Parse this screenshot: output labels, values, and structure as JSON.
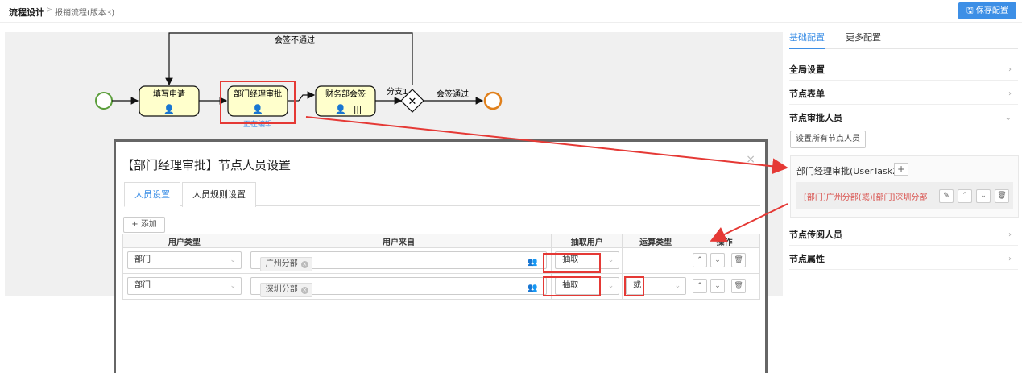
{
  "breadcrumb": {
    "root": "流程设计",
    "sep": ">",
    "current": "报销流程(版本3)"
  },
  "toolbar": {
    "save_label": "保存配置"
  },
  "diagram": {
    "loop_label": "会签不通过",
    "nodes": {
      "fill": "填写申请",
      "manager": "部门经理审批",
      "finance": "财务部会签"
    },
    "branch_label": "分支1",
    "pass_label": "会签通过",
    "editing_label": "正在编辑"
  },
  "right_panel": {
    "tabs": [
      "基础配置",
      "更多配置"
    ],
    "sections": [
      "全局设置",
      "节点表单",
      "节点审批人员",
      "节点传阅人员",
      "节点属性"
    ],
    "set_all_label": "设置所有节点人员",
    "node_title": "部门经理审批(UserTask2)",
    "node_rule": "[部门]广州分部(或)[部门]深圳分部"
  },
  "dialog": {
    "title": "【部门经理审批】节点人员设置",
    "close": "×",
    "tabs": [
      "人员设置",
      "人员规则设置"
    ],
    "add_label": "+ 添加",
    "columns": [
      "用户类型",
      "用户来自",
      "抽取用户",
      "运算类型",
      "操作"
    ],
    "rows": [
      {
        "type": "部门",
        "source": "广州分部",
        "extract": "抽取",
        "op": ""
      },
      {
        "type": "部门",
        "source": "深圳分部",
        "extract": "抽取",
        "op": "或"
      }
    ]
  },
  "colors": {
    "accent": "#3d8fe6",
    "highlight": "#e53935",
    "task_fill": "#ffffcc",
    "start": "#5b9e3b",
    "end": "#e0801c"
  }
}
